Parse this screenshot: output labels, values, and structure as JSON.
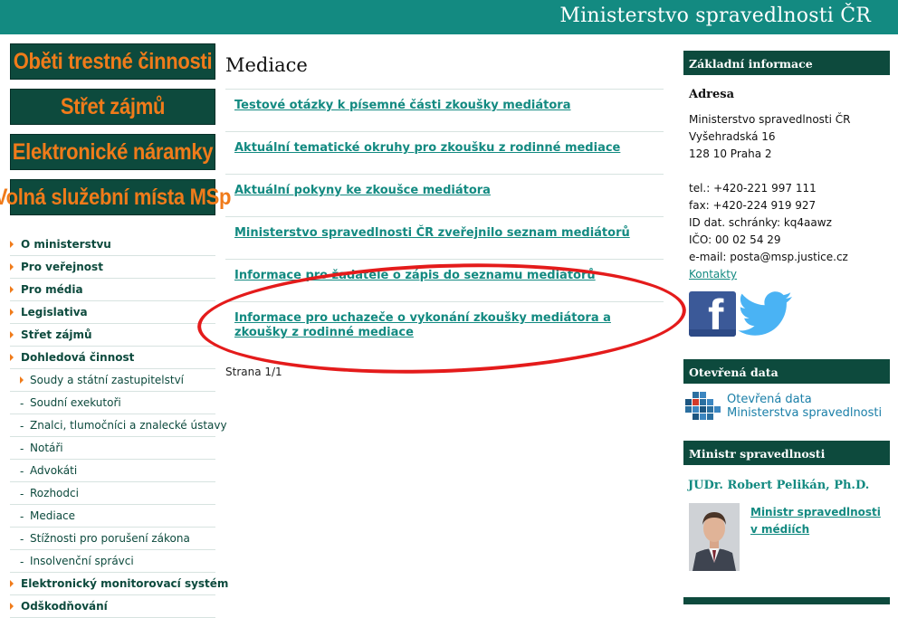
{
  "header": {
    "site_title": "Ministerstvo spravedlnosti ČR"
  },
  "banners": [
    "Oběti trestné činnosti",
    "Střet zájmů",
    "Elektronické náramky",
    "Volná služební místa MSp"
  ],
  "left_menu": [
    {
      "label": "O ministerstvu",
      "type": "main"
    },
    {
      "label": "Pro veřejnost",
      "type": "main"
    },
    {
      "label": "Pro média",
      "type": "main"
    },
    {
      "label": "Legislativa",
      "type": "main"
    },
    {
      "label": "Střet zájmů",
      "type": "main"
    },
    {
      "label": "Dohledová činnost",
      "type": "main"
    },
    {
      "label": "Soudy a státní zastupitelství",
      "type": "sub-arrow"
    },
    {
      "label": "Soudní exekutoři",
      "type": "sub"
    },
    {
      "label": "Znalci, tlumočníci a znalecké ústavy",
      "type": "sub"
    },
    {
      "label": "Notáři",
      "type": "sub"
    },
    {
      "label": "Advokáti",
      "type": "sub"
    },
    {
      "label": "Rozhodci",
      "type": "sub"
    },
    {
      "label": "Mediace",
      "type": "sub"
    },
    {
      "label": "Stížnosti pro porušení zákona",
      "type": "sub"
    },
    {
      "label": "Insolvenční správci",
      "type": "sub"
    },
    {
      "label": "Elektronický monitorovací systém",
      "type": "main"
    },
    {
      "label": "Odškodňování",
      "type": "main"
    }
  ],
  "main": {
    "title": "Mediace",
    "articles": [
      "Testové otázky k písemné části zkoušky mediátora",
      "Aktuální tematické okruhy pro zkoušku z rodinné mediace",
      "Aktuální pokyny ke zkoušce mediátora",
      "Ministerstvo spravedlnosti ČR zveřejnilo seznam mediátorů",
      "Informace pro žadatele o zápis do seznamu mediátorů",
      "Informace pro uchazeče o vykonání zkoušky mediátora a zkoušky z rodinné mediace"
    ],
    "pager": "Strana 1/1"
  },
  "right": {
    "basic_info_title": "Základní informace",
    "address_title": "Adresa",
    "address_lines": [
      "Ministerstvo spravedlnosti ČR",
      "Vyšehradská 16",
      "128 10 Praha 2",
      "",
      "tel.: +420-221 997 111",
      "fax: +420-224 919 927",
      "ID dat. schránky: kq4aawz",
      "IČO: 00 02 54 29",
      "e-mail: posta@msp.justice.cz"
    ],
    "contacts_link": "Kontakty",
    "open_data_title": "Otevřená data",
    "open_data_text_1": "Otevřená data",
    "open_data_text_2": "Ministerstva spravedlnosti",
    "minister_title": "Ministr spravedlnosti",
    "minister_name": "JUDr. Robert Pelikán, Ph.D.",
    "minister_link": "Ministr spravedlnosti v médiích"
  },
  "colors": {
    "header_teal": "#138a81",
    "dark_green": "#0d4a3d",
    "banner_orange": "#f07b1a",
    "highlight_red": "#e41b1b"
  },
  "icons": [
    "facebook-icon",
    "twitter-icon",
    "open-data-cubes-icon",
    "menu-arrow-icon"
  ]
}
